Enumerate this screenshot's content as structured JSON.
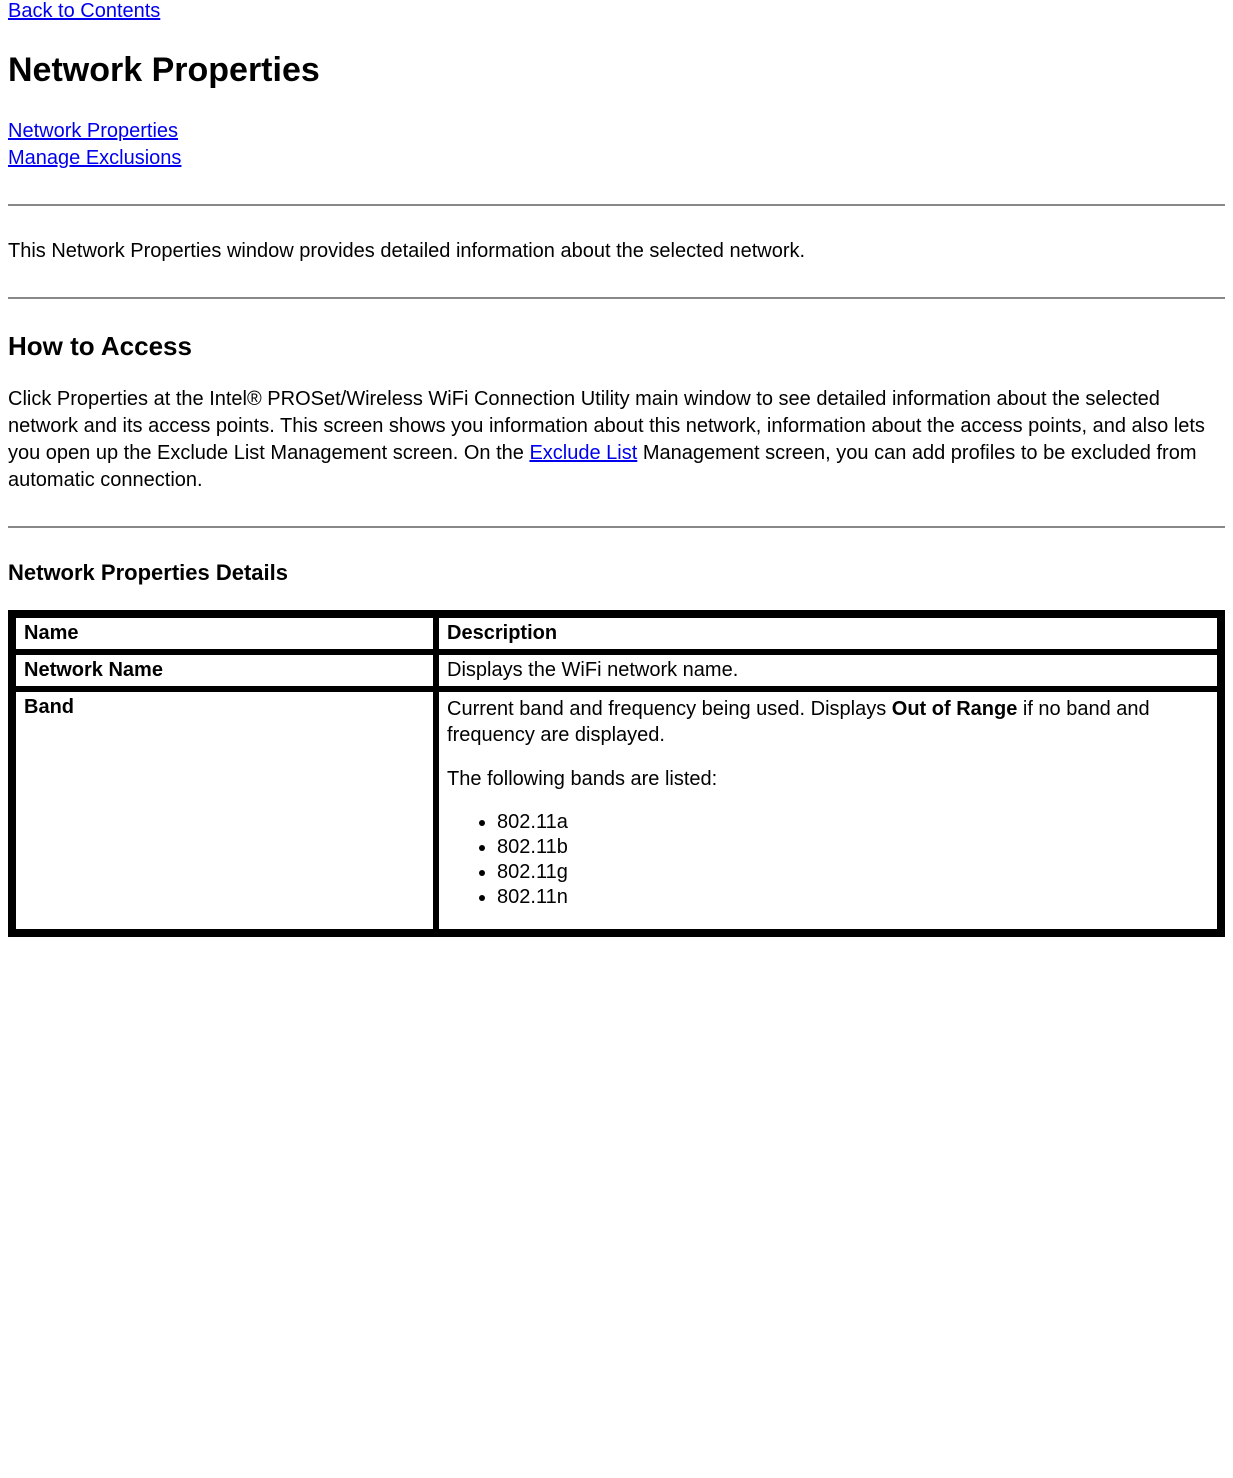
{
  "top_link": "Back to Contents",
  "title": "Network Properties",
  "nav": {
    "link1": "Network Properties",
    "link2": "Manage Exclusions"
  },
  "intro": "This Network Properties window provides detailed information about the selected network.",
  "section_access": {
    "heading": "How to Access",
    "para_before": "Click Properties at the Intel® PROSet/Wireless WiFi Connection Utility main window to see detailed information about the selected network and its access points. This screen shows you information about this network, information about the access points, and also lets you open up the Exclude List Management screen. On the ",
    "link_text": "Exclude List",
    "para_after": " Management screen, you can add profiles to be excluded from automatic connection."
  },
  "section_details": {
    "heading": "Network Properties Details",
    "headers": {
      "name": "Name",
      "description": "Description"
    },
    "rows": {
      "network_name": {
        "name": "Network Name",
        "desc": "Displays the WiFi network name."
      },
      "band": {
        "name": "Band",
        "desc_before": "Current band and frequency being used. Displays ",
        "desc_bold": "Out of Range",
        "desc_after": " if no band and frequency are displayed.",
        "list_intro": "The following bands are listed:",
        "bands": [
          "802.11a",
          "802.11b",
          "802.11g",
          "802.11n"
        ]
      }
    }
  }
}
